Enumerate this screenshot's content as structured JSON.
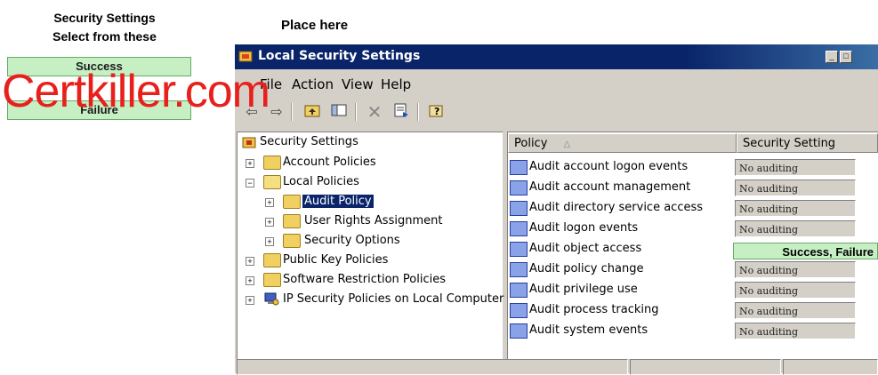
{
  "instructions": {
    "line1": "Security Settings",
    "line2": "Select from these",
    "place_here": "Place here",
    "options": [
      "Success",
      "Failure"
    ]
  },
  "watermark": "Certkiller.com",
  "window": {
    "title": "Local Security Settings",
    "menu": [
      "File",
      "Action",
      "View",
      "Help"
    ],
    "toolbar_icons": [
      "back-arrow-icon",
      "forward-arrow-icon",
      "up-folder-icon",
      "show-hide-tree-icon",
      "delete-icon",
      "export-list-icon",
      "help-icon"
    ]
  },
  "tree": {
    "root": "Security Settings",
    "items": [
      {
        "label": "Account Policies",
        "level": 1
      },
      {
        "label": "Local Policies",
        "level": 1
      },
      {
        "label": "Audit Policy",
        "level": 2,
        "selected": true
      },
      {
        "label": "User Rights Assignment",
        "level": 2
      },
      {
        "label": "Security Options",
        "level": 2
      },
      {
        "label": "Public Key Policies",
        "level": 1
      },
      {
        "label": "Software Restriction Policies",
        "level": 1
      },
      {
        "label": "IP Security Policies on Local Computer",
        "level": 1
      }
    ]
  },
  "list": {
    "columns": [
      "Policy",
      "Security Setting"
    ],
    "rows": [
      {
        "policy": "Audit account logon events",
        "setting": "No auditing"
      },
      {
        "policy": "Audit account management",
        "setting": "No auditing"
      },
      {
        "policy": "Audit directory service access",
        "setting": "No auditing"
      },
      {
        "policy": "Audit logon events",
        "setting": "No auditing"
      },
      {
        "policy": "Audit object access",
        "setting": "Success, Failure"
      },
      {
        "policy": "Audit policy change",
        "setting": "No auditing"
      },
      {
        "policy": "Audit privilege use",
        "setting": "No auditing"
      },
      {
        "policy": "Audit process tracking",
        "setting": "No auditing"
      },
      {
        "policy": "Audit system events",
        "setting": "No auditing"
      }
    ]
  }
}
